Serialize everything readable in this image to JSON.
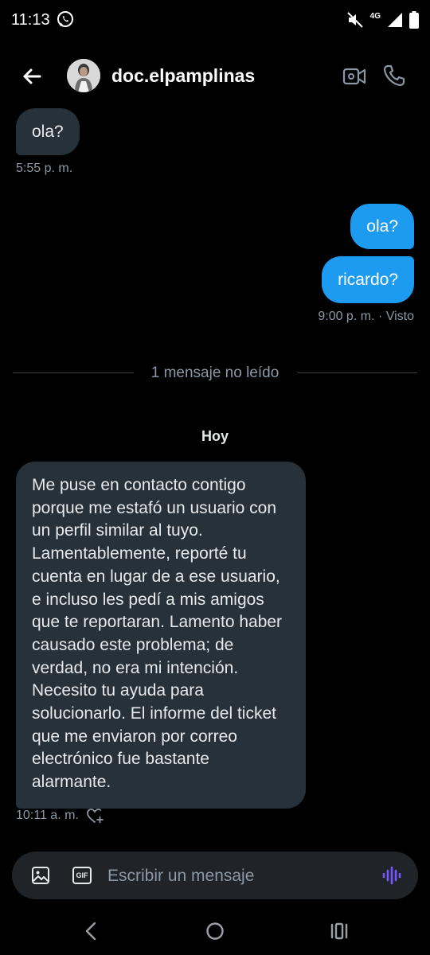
{
  "status_bar": {
    "time": "11:13",
    "network": "4G"
  },
  "header": {
    "username": "doc.elpamplinas"
  },
  "messages": [
    {
      "text": "ola?"
    },
    {
      "text": "ola?"
    },
    {
      "text": "ricardo?"
    },
    {
      "text": "Me puse en contacto contigo porque me estafó un usuario con un perfil similar al tuyo. Lamentablemente, reporté tu cuenta en lugar de a ese usuario, e incluso les pedí a mis amigos que te reportaran. Lamento haber causado este problema; de verdad, no era mi intención. Necesito tu ayuda para solucionarlo. El informe del ticket que me enviaron por correo electrónico fue bastante alarmante."
    }
  ],
  "meta": {
    "first_time": "5:55 p. m.",
    "sent_status": "9:00 p. m. · Visto",
    "unread_divider": "1 mensaje no leído",
    "day_label": "Hoy",
    "last_time": "10:11 a. m."
  },
  "composer": {
    "gif_label": "GIF",
    "placeholder": "Escribir un mensaje"
  },
  "colors": {
    "accent": "#1d9bf0",
    "incoming_bubble": "#26313a",
    "voice_icon": "#7856ff"
  }
}
